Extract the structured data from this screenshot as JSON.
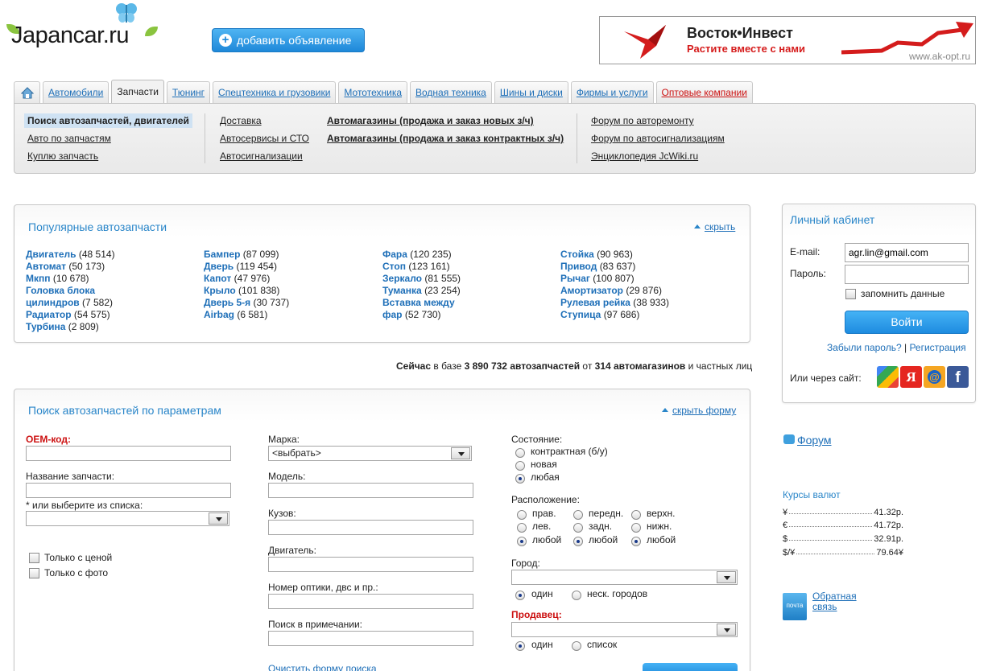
{
  "header": {
    "logo": "Japancar.ru",
    "add_button": "добавить объявление",
    "banner": {
      "title": "Восток•Инвест",
      "subtitle": "Растите вместе с нами",
      "url": "www.ak-opt.ru"
    }
  },
  "tabs": [
    {
      "label": "Автомобили"
    },
    {
      "label": "Запчасти"
    },
    {
      "label": "Тюнинг"
    },
    {
      "label": "Спецтехника и грузовики"
    },
    {
      "label": "Мототехника"
    },
    {
      "label": "Водная техника"
    },
    {
      "label": "Шины и диски"
    },
    {
      "label": "Фирмы и услуги"
    },
    {
      "label": "Оптовые компании"
    }
  ],
  "subnav": {
    "col1": [
      "Поиск автозапчастей, двигателей",
      "Авто по запчастям",
      "Куплю запчасть"
    ],
    "col2": [
      "Доставка",
      "Автосервисы и СТО",
      "Автосигнализации"
    ],
    "col3": [
      "Автомагазины (продажа и заказ новых з/ч)",
      "Автомагазины (продажа и заказ контрактных з/ч)"
    ],
    "col4": [
      "Форум по авторемонту",
      "Форум по автосигнализациям",
      "Энциклопедия JcWiki.ru"
    ]
  },
  "popular": {
    "title": "Популярные автозапчасти",
    "hide": "скрыть",
    "columns": [
      [
        {
          "name": "Двигатель",
          "count": "(48 514)"
        },
        {
          "name": "Автомат",
          "count": "(50 173)"
        },
        {
          "name": "Мкпп",
          "count": "(10 678)"
        },
        {
          "name": "Головка блока",
          "count": ""
        },
        {
          "name": "цилиндров",
          "count": "(7 582)"
        },
        {
          "name": "Радиатор",
          "count": "(54 575)"
        },
        {
          "name": "Турбина",
          "count": "(2 809)"
        }
      ],
      [
        {
          "name": "Бампер",
          "count": "(87 099)"
        },
        {
          "name": "Дверь",
          "count": "(119 454)"
        },
        {
          "name": "Капот",
          "count": "(47 976)"
        },
        {
          "name": "Крыло",
          "count": "(101 838)"
        },
        {
          "name": "Дверь 5-я",
          "count": "(30 737)"
        },
        {
          "name": "Airbag",
          "count": "(6 581)"
        }
      ],
      [
        {
          "name": "Фара",
          "count": "(120 235)"
        },
        {
          "name": "Стоп",
          "count": "(123 161)"
        },
        {
          "name": "Зеркало",
          "count": "(81 555)"
        },
        {
          "name": "Туманка",
          "count": "(23 254)"
        },
        {
          "name": "Вставка между",
          "count": ""
        },
        {
          "name": "фар",
          "count": "(52 730)"
        }
      ],
      [
        {
          "name": "Стойка",
          "count": "(90 963)"
        },
        {
          "name": "Привод",
          "count": "(83 637)"
        },
        {
          "name": "Рычаг",
          "count": "(100 807)"
        },
        {
          "name": "Амортизатор",
          "count": "(29 876)"
        },
        {
          "name": "Рулевая рейка",
          "count": "(38 933)"
        },
        {
          "name": "Ступица",
          "count": "(97 686)"
        }
      ]
    ]
  },
  "stats": {
    "p1": "Сейчас",
    "p2": " в базе ",
    "p3": "3 890 732 автозапчастей",
    "p4": " от ",
    "p5": "314 автомагазинов",
    "p6": " и частных лиц"
  },
  "search": {
    "title": "Поиск автозапчастей по параметрам",
    "hide": "скрыть форму",
    "oem_label": "OEM-код:",
    "part_name_label": "Название запчасти:",
    "or_select_label": "* или выберите из списка:",
    "only_price": "Только с ценой",
    "only_photo": "Только с фото",
    "brand_label": "Марка:",
    "brand_value": "<выбрать>",
    "model_label": "Модель:",
    "body_label": "Кузов:",
    "engine_label": "Двигатель:",
    "optics_label": "Номер оптики, двс и пр.:",
    "note_label": "Поиск в примечании:",
    "clear_link": "Очистить форму поиска",
    "condition_label": "Состояние:",
    "conditions": [
      "контрактная (б/у)",
      "новая",
      "любая"
    ],
    "location_label": "Расположение:",
    "loc_col1": [
      "прав.",
      "лев.",
      "любой"
    ],
    "loc_col2": [
      "передн.",
      "задн.",
      "любой"
    ],
    "loc_col3": [
      "верхн.",
      "нижн.",
      "любой"
    ],
    "city_label": "Город:",
    "city_opts": [
      "один",
      "неск. городов"
    ],
    "seller_label": "Продавец:",
    "seller_opts": [
      "один",
      "список"
    ]
  },
  "sidebar": {
    "cabinet_title": "Личный кабинет",
    "email_label": "E-mail:",
    "email_value": "agr.lin@gmail.com",
    "password_label": "Пароль:",
    "remember": "запомнить данные",
    "login_button": "Войти",
    "forgot": "Забыли пароль?",
    "sep": " | ",
    "register": "Регистрация",
    "or_via": "Или через сайт:",
    "forum": "Форум",
    "rates_title": "Курсы валют",
    "rates": [
      {
        "sym": "¥",
        "val": "41.32р."
      },
      {
        "sym": "€",
        "val": "41.72р."
      },
      {
        "sym": "$",
        "val": "32.91р."
      },
      {
        "sym": "$/¥",
        "val": "79.64¥"
      }
    ],
    "feedback": "Обратная связь",
    "mail_icon_text": "почта"
  }
}
